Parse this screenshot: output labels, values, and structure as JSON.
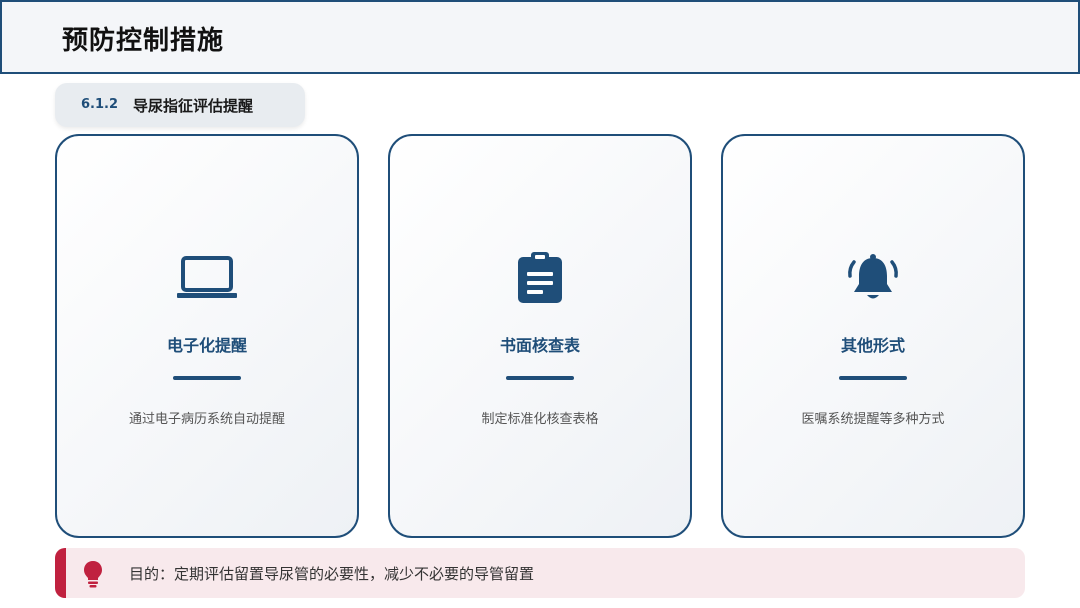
{
  "header": {
    "title": "预防控制措施"
  },
  "section": {
    "number": "6.1.2",
    "label": "导尿指征评估提醒"
  },
  "cards": [
    {
      "icon": "laptop-icon",
      "title": "电子化提醒",
      "desc": "通过电子病历系统自动提醒"
    },
    {
      "icon": "clipboard-icon",
      "title": "书面核查表",
      "desc": "制定标准化核查表格"
    },
    {
      "icon": "bell-icon",
      "title": "其他形式",
      "desc": "医嘱系统提醒等多种方式"
    }
  ],
  "note": {
    "icon": "lightbulb-icon",
    "text": "目的：定期评估留置导尿管的必要性，减少不必要的导管留置"
  },
  "colors": {
    "primary": "#1f4e79",
    "accent": "#c0213f",
    "note_bg": "#f8e9ec"
  }
}
